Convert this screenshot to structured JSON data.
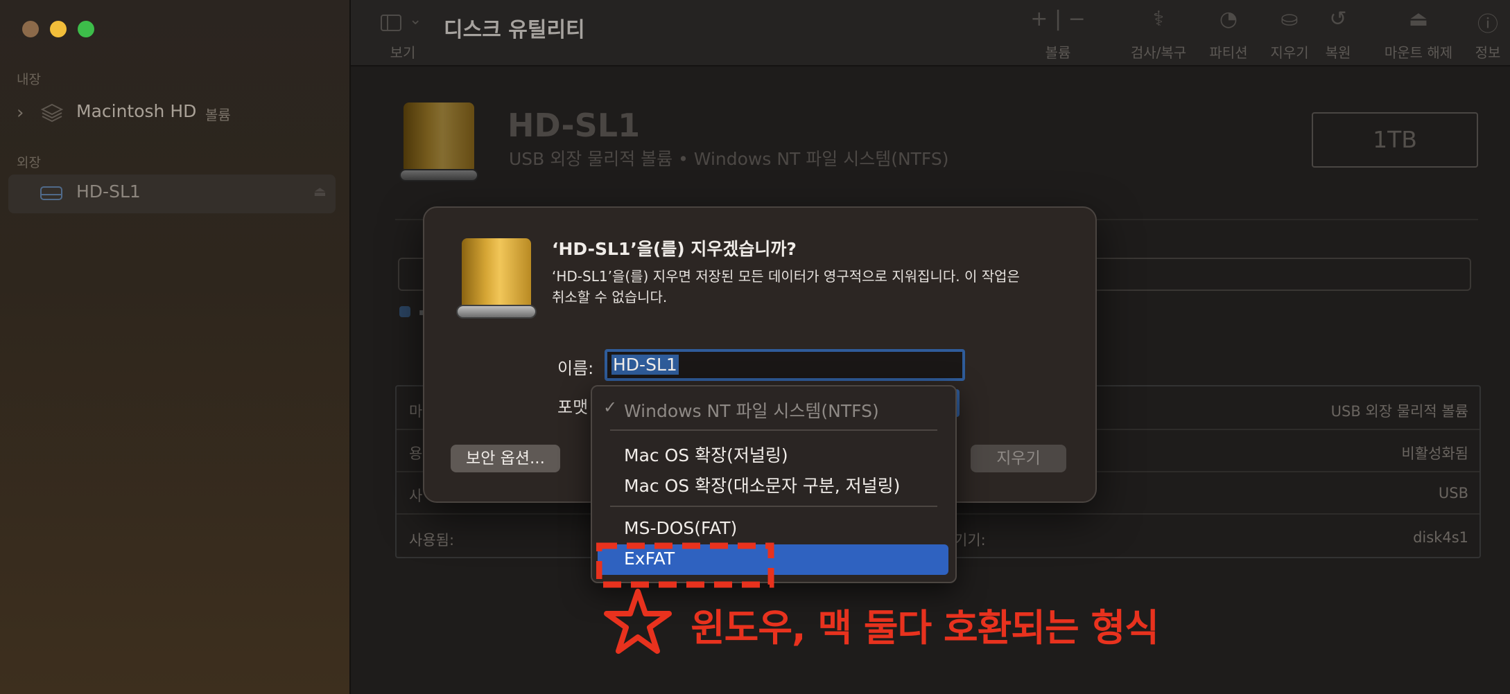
{
  "window": {
    "title": "디스크 유틸리티"
  },
  "sidebar": {
    "section_internal": "내장",
    "internal_items": [
      {
        "label": "Macintosh HD",
        "badge": "볼륨"
      }
    ],
    "section_external": "외장",
    "external_items": [
      {
        "label": "HD-SL1"
      }
    ]
  },
  "toolbar": {
    "view_label": "보기",
    "volume_label": "볼륨",
    "first_aid_label": "검사/복구",
    "partition_label": "파티션",
    "erase_label": "지우기",
    "restore_label": "복원",
    "unmount_label": "마운트 해제",
    "info_label": "정보"
  },
  "disk": {
    "name": "HD-SL1",
    "subtitle": "USB 외장 물리적 볼륨 • Windows NT 파일 시스템(NTFS)",
    "capacity": "1TB"
  },
  "info_table": {
    "right_values": [
      "USB 외장 물리적 볼륨",
      "비활성화됨",
      "USB",
      "disk4s1"
    ],
    "left_row_start": [
      "마",
      "용",
      "사"
    ],
    "used_label": "사용됨:",
    "device_label_tail": "기기:"
  },
  "dialog": {
    "title": "‘HD-SL1’을(를) 지우겠습니까?",
    "message_line1": "‘HD-SL1’을(를) 지우면 저장된 모든 데이터가 영구적으로 지워집니다. 이 작업은",
    "message_line2": "취소할 수 없습니다.",
    "name_label": "이름:",
    "name_value": "HD-SL1",
    "format_label": "포맷",
    "security_button": "보안 옵션...",
    "erase_button": "지우기"
  },
  "format_menu": {
    "checkmark": "✓",
    "checked_item": "Windows NT 파일 시스템(NTFS)",
    "group2": [
      "Mac OS 확장(저널링)",
      "Mac OS 확장(대소문자 구분, 저널링)"
    ],
    "group3_item": "MS-DOS(FAT)",
    "selected_item": "ExFAT",
    "highlight_color": "#2f62c0"
  },
  "annotation": {
    "star": "★",
    "text": "윈도우, 맥 둘다 호환되는 형식",
    "color": "#e8321e"
  }
}
